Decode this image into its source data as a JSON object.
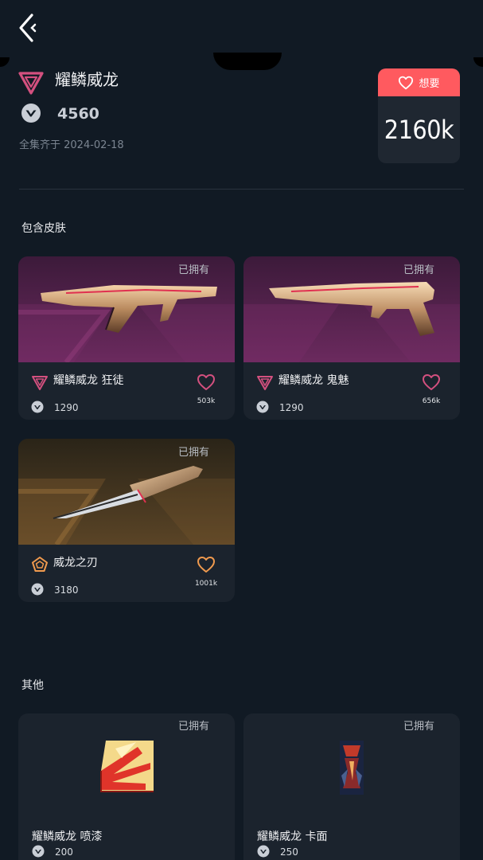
{
  "header": {
    "bundle_name": "耀鳞威龙",
    "price": "4560",
    "date_text": "全集齐于 2024-02-18"
  },
  "want": {
    "label": "想要",
    "count": "2160k"
  },
  "sections": {
    "skins_title": "包含皮肤",
    "other_title": "其他"
  },
  "skins": [
    {
      "owned": "已拥有",
      "name": "耀鳞威龙 狂徒",
      "price": "1290",
      "fav_count": "503k",
      "tier": "premium"
    },
    {
      "owned": "已拥有",
      "name": "耀鳞威龙 鬼魅",
      "price": "1290",
      "fav_count": "656k",
      "tier": "premium"
    },
    {
      "owned": "已拥有",
      "name": "威龙之刃",
      "price": "3180",
      "fav_count": "1001k",
      "tier": "exclusive"
    }
  ],
  "others": [
    {
      "owned": "已拥有",
      "name": "耀鳞威龙 喷漆",
      "price": "200"
    },
    {
      "owned": "已拥有",
      "name": "耀鳞威龙 卡面",
      "price": "250"
    }
  ],
  "colors": {
    "accent": "#ff5a5f",
    "premium": "#d4507f",
    "exclusive": "#f09a4e",
    "background": "#111a24",
    "card": "#1b232d"
  },
  "icons": {
    "back": "back-arrow-icon",
    "tier_premium": "premium-tier-icon",
    "tier_exclusive": "exclusive-tier-icon",
    "currency": "valorant-points-icon",
    "favorite": "heart-icon"
  }
}
